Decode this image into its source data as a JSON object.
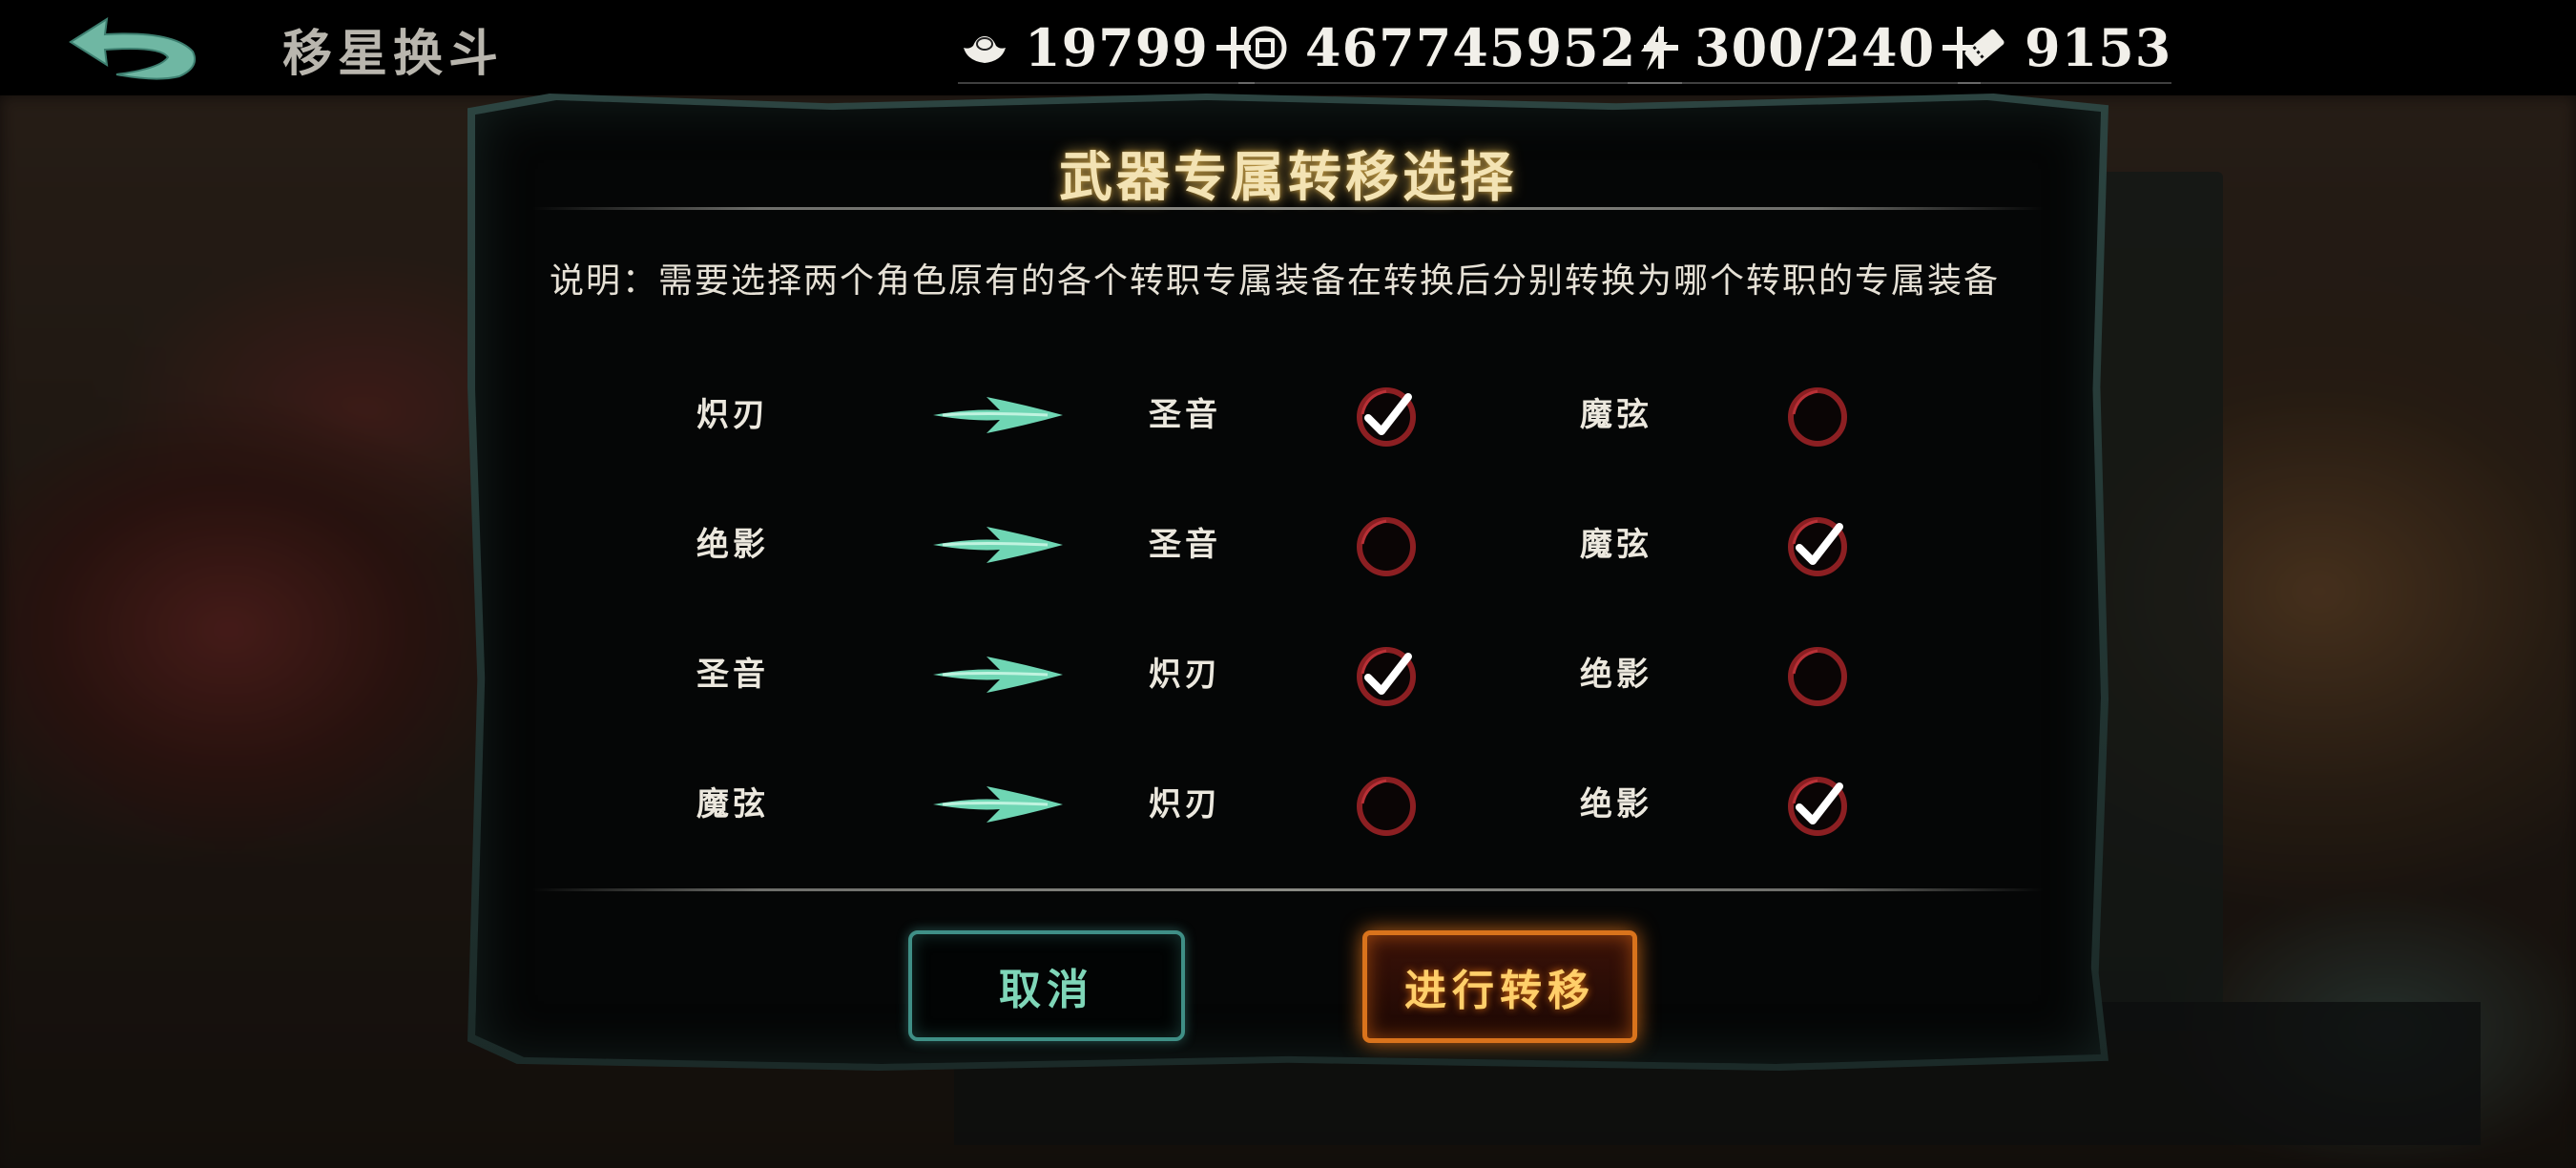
{
  "header": {
    "title": "移星换斗"
  },
  "resources": [
    {
      "name": "gold-ingot",
      "value": "19799"
    },
    {
      "name": "coin",
      "value": "467745952"
    },
    {
      "name": "energy",
      "value": "300/240"
    },
    {
      "name": "ticket",
      "value": "9153"
    }
  ],
  "dialog": {
    "title": "武器专属转移选择",
    "description": "说明：需要选择两个角色原有的各个转职专属装备在转换后分别转换为哪个转职的专属装备",
    "rows": [
      {
        "source": "炽刃",
        "option_a": "圣音",
        "option_a_checked": true,
        "option_b": "魔弦",
        "option_b_checked": false
      },
      {
        "source": "绝影",
        "option_a": "圣音",
        "option_a_checked": false,
        "option_b": "魔弦",
        "option_b_checked": true
      },
      {
        "source": "圣音",
        "option_a": "炽刃",
        "option_a_checked": true,
        "option_b": "绝影",
        "option_b_checked": false
      },
      {
        "source": "魔弦",
        "option_a": "炽刃",
        "option_a_checked": false,
        "option_b": "绝影",
        "option_b_checked": true
      }
    ],
    "cancel_label": "取消",
    "confirm_label": "进行转移"
  },
  "colors": {
    "accent_teal": "#3f8f86",
    "confirm_orange": "#d9731c",
    "check_ring": "#8c1f22",
    "title_gold": "#f3e3b4"
  }
}
